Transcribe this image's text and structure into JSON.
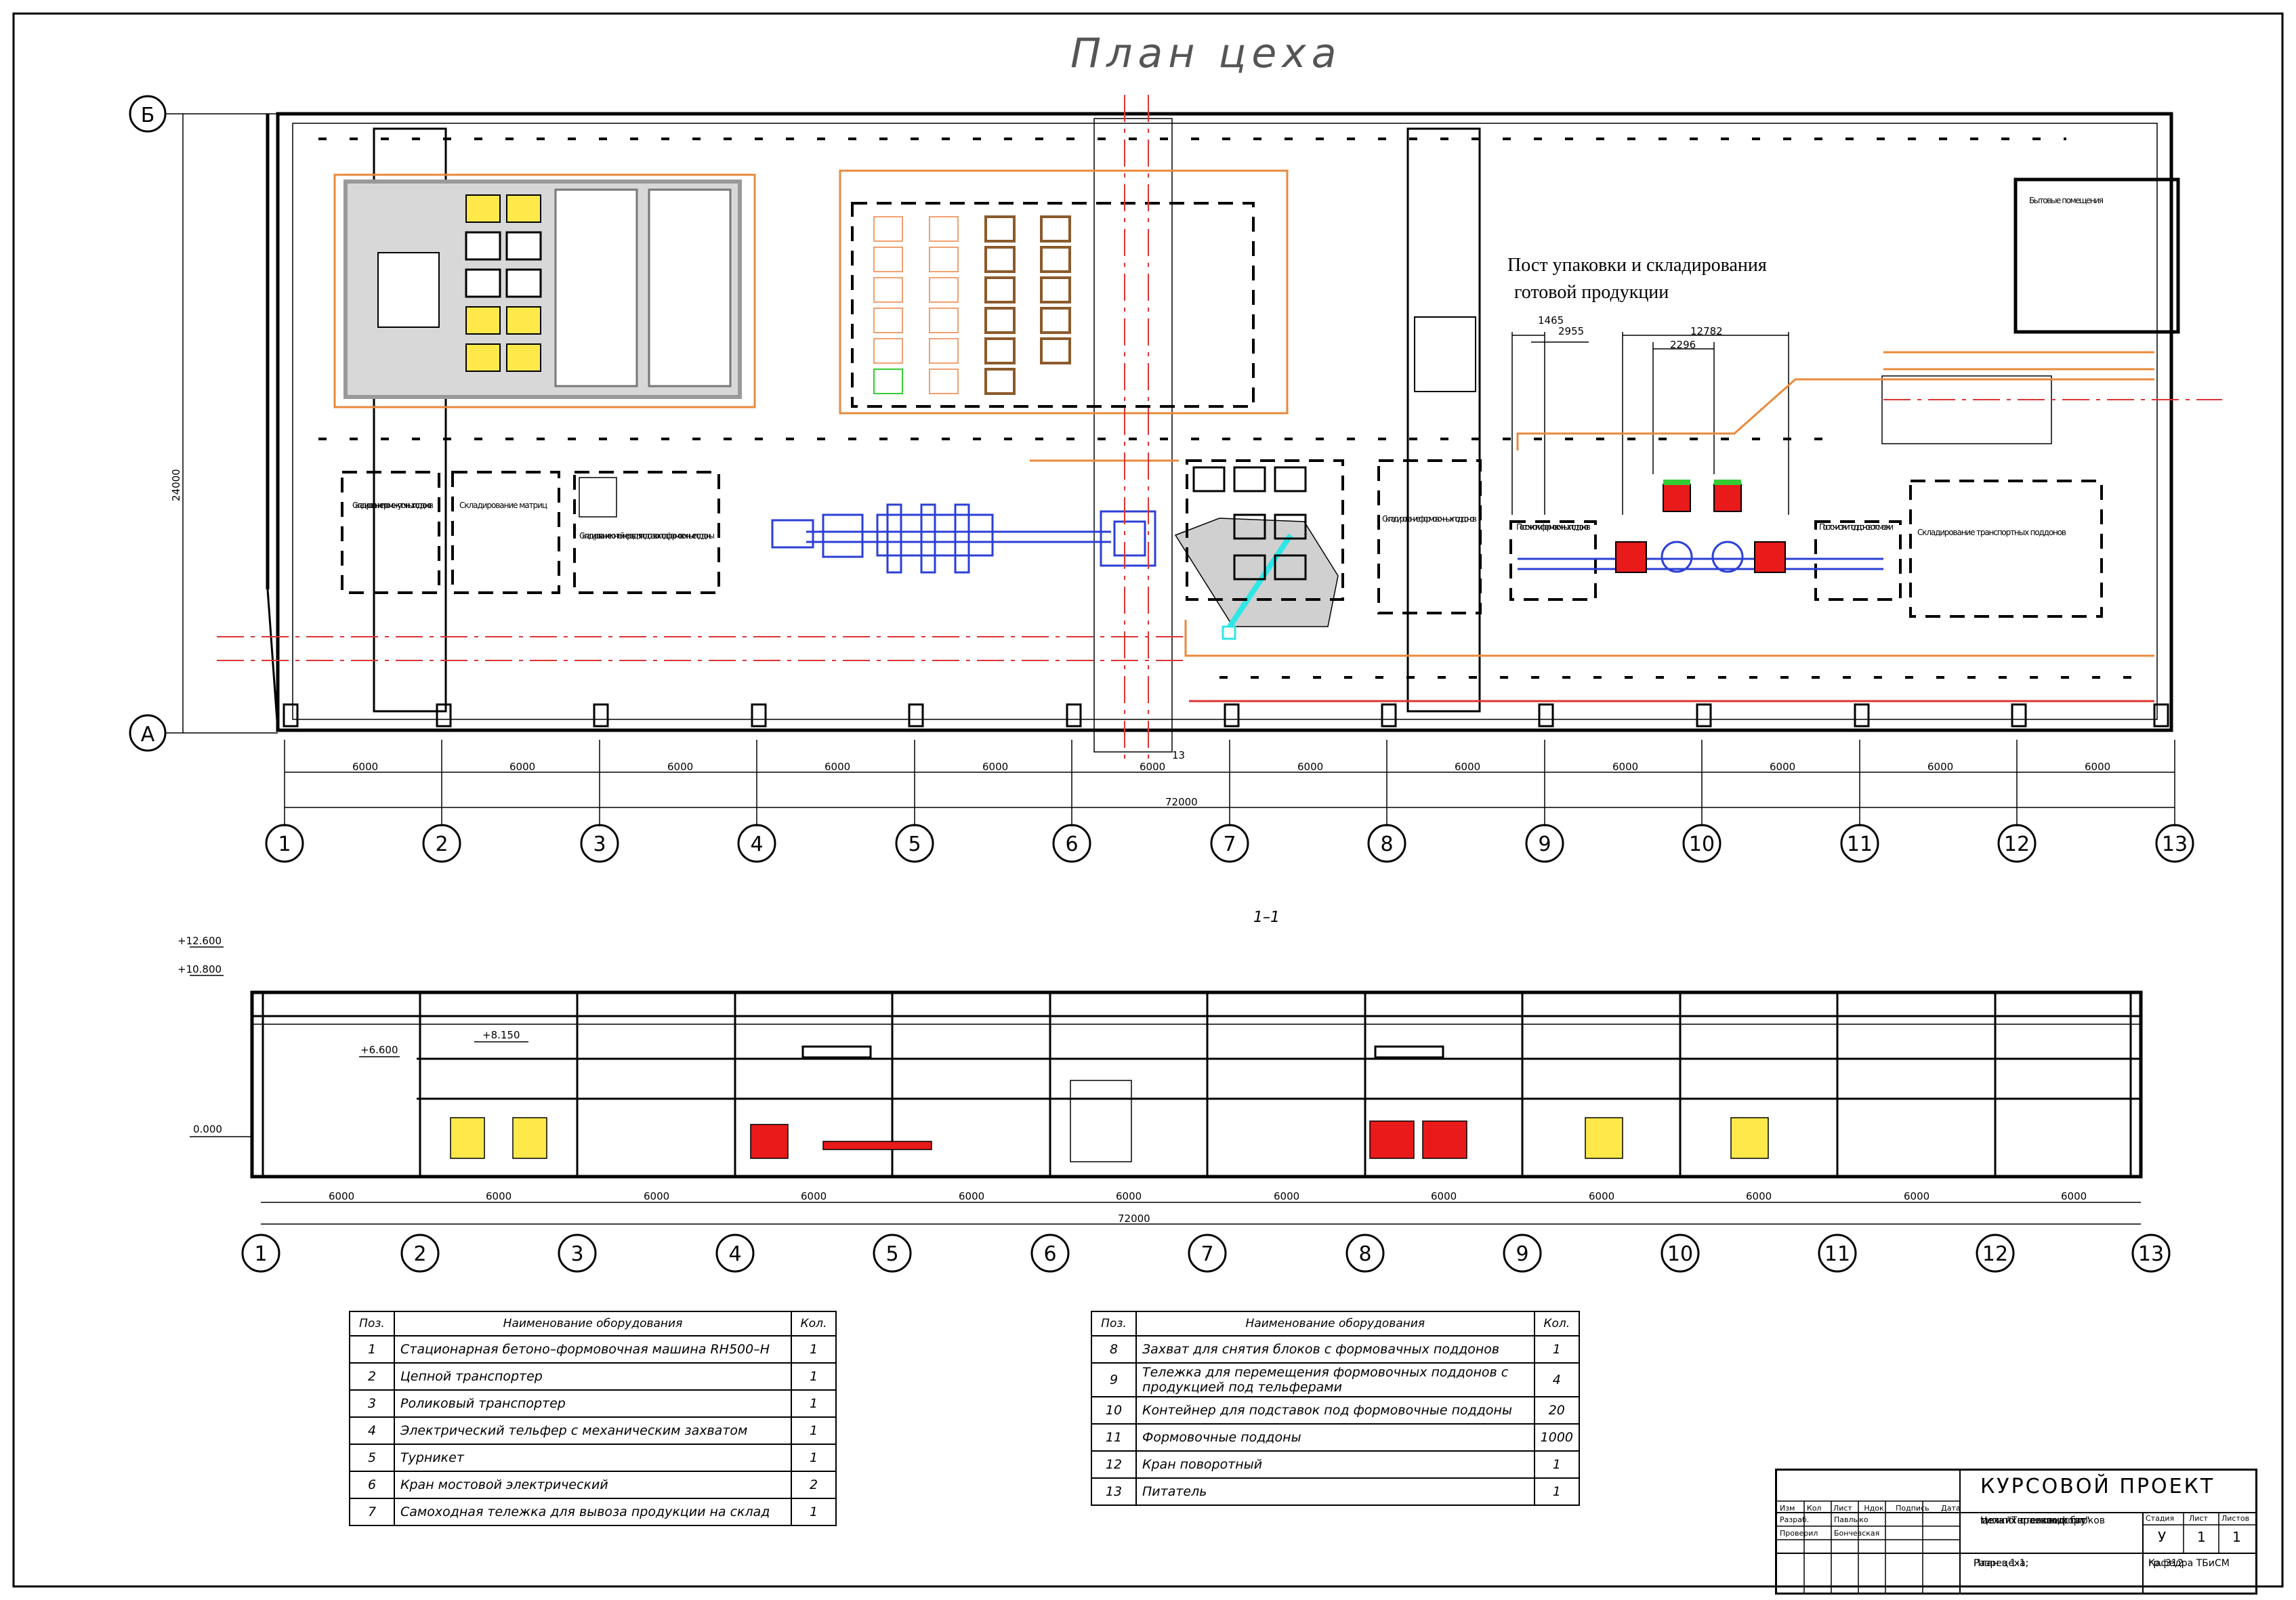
{
  "title": "План цеха",
  "post_label": [
    "Пост упаковки и складирования",
    "готовой продукции"
  ],
  "section_label": "1–1",
  "plan_axes": [
    "1",
    "2",
    "3",
    "4",
    "5",
    "6",
    "7",
    "8",
    "9",
    "10",
    "11",
    "12",
    "13"
  ],
  "section_axes": [
    "1",
    "2",
    "3",
    "4",
    "5",
    "6",
    "7",
    "8",
    "9",
    "10",
    "11",
    "12",
    "13"
  ],
  "row_axes": [
    "Б",
    "А"
  ],
  "span_label": "6000",
  "total_label": "72000",
  "height_label": "24000",
  "marker_13": "13",
  "dims_top": [
    "1465",
    "2955",
    "12782",
    "2296"
  ],
  "levels": [
    "+12.600",
    "+10.800",
    "+6.600",
    "+8.150",
    "0.000"
  ],
  "zones": {
    "z1": "Складирование промежуточных поддонов",
    "z2": "Складирование матриц",
    "z3": "Складирование контейнеров для подставок под формовочные поддоны",
    "z4": "Складирование формовочных поддонов",
    "z5": "Складирование транспортных поддонов",
    "z6": "Бытовые помещения",
    "z7": "Пост очистки формовочных поддонов",
    "z8": "Пост очистки поддонов от смазки"
  },
  "table_left": {
    "headers": [
      "Поз.",
      "Наименование оборудования",
      "Кол."
    ],
    "rows": [
      [
        "1",
        "Стационарная бетоно–формовочная машина RH500–H",
        "1"
      ],
      [
        "2",
        "Цепной транспортер",
        "1"
      ],
      [
        "3",
        "Роликовый транспортер",
        "1"
      ],
      [
        "4",
        "Электрический тельфер с механическим захватом",
        "1"
      ],
      [
        "5",
        "Турникет",
        "1"
      ],
      [
        "6",
        "Кран мостовой электрический",
        "2"
      ],
      [
        "7",
        "Самоходная тележка для вывоза продукции на склад",
        "1"
      ]
    ]
  },
  "table_right": {
    "headers": [
      "Поз.",
      "Наименование оборудования",
      "Кол."
    ],
    "rows": [
      [
        "8",
        "Захват для снятия блоков с формовачных поддонов",
        "1"
      ],
      [
        "9",
        "Тележка для перемещения формовочных поддонов с продукцией под тельферами",
        "4"
      ],
      [
        "10",
        "Контейнер для подставок под формовочные поддоны",
        "20"
      ],
      [
        "11",
        "Формовочные поддоны",
        "1000"
      ],
      [
        "12",
        "Кран поворотный",
        "1"
      ],
      [
        "13",
        "Питатель",
        "1"
      ]
    ]
  },
  "stamp": {
    "project": "КУРСОВОЙ ПРОЕКТ",
    "cols": [
      "Изм",
      "Кол",
      "Лист",
      "Ндок",
      "Подпись",
      "Дата"
    ],
    "r1": [
      "Разраб.",
      "Павлыко"
    ],
    "r2": [
      "Проверил",
      "Бончевская"
    ],
    "desc": [
      "Цех по производству",
      "мелких стеновых блоков",
      "типа \"Теплокомфорт\""
    ],
    "stage_h": [
      "Стадия",
      "Лист",
      "Листов"
    ],
    "stage_v": [
      "У",
      "1",
      "1"
    ],
    "sheet": [
      "План цеха;",
      "Разрез 1-1;"
    ],
    "dept": [
      "Кафедра ТБиСМ",
      "гр. 312"
    ]
  }
}
